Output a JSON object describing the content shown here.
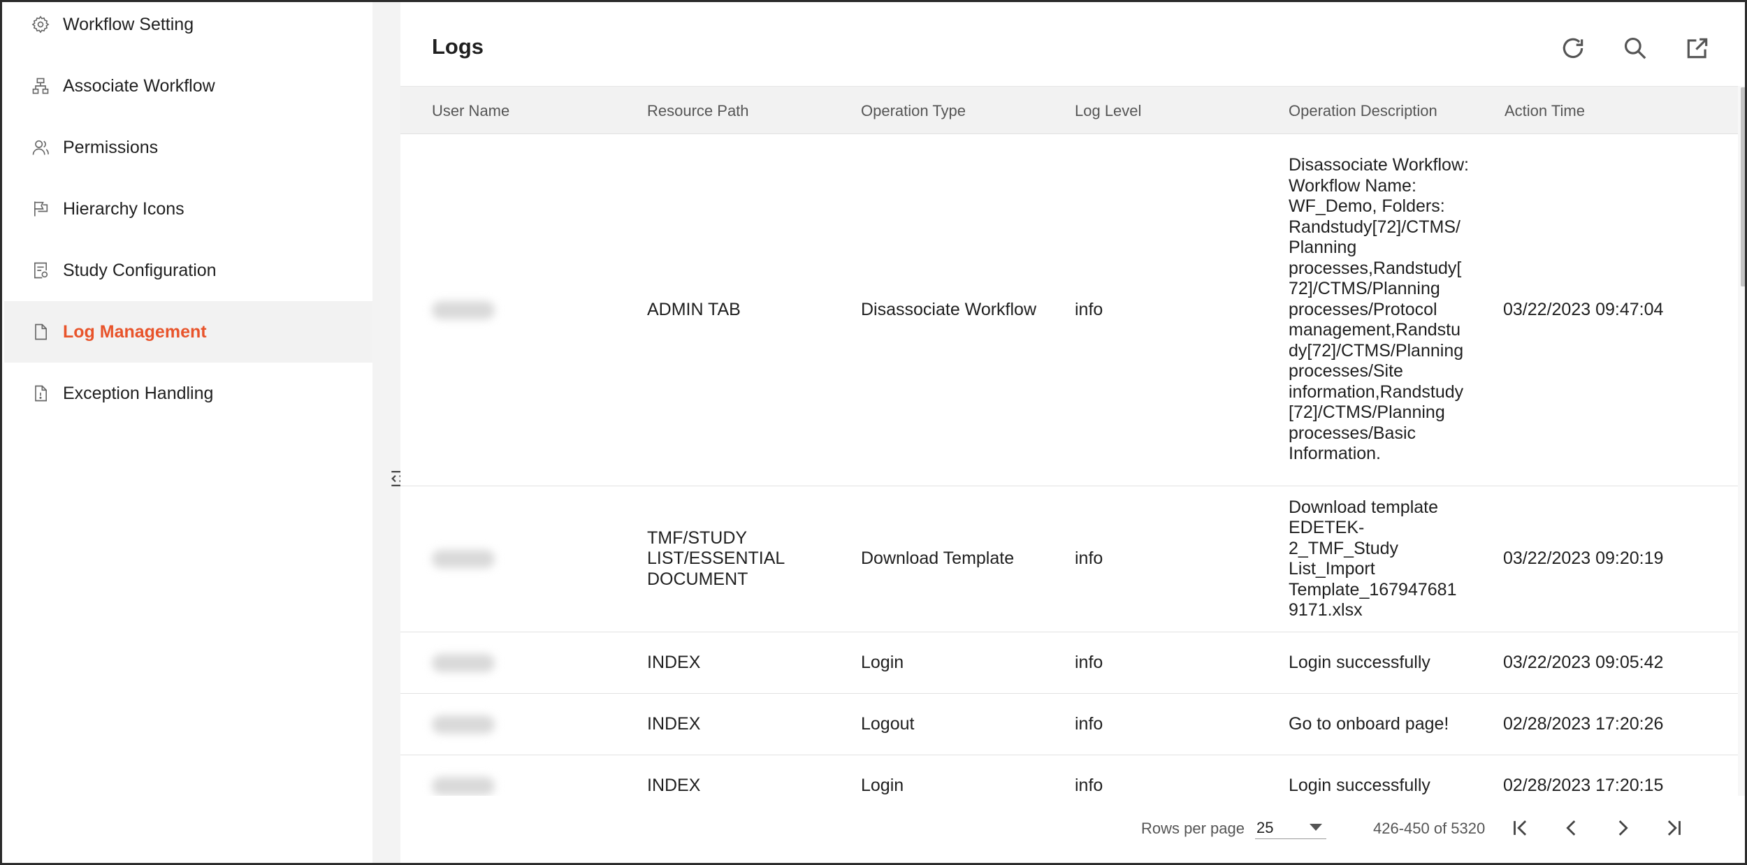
{
  "sidebar": {
    "items": [
      {
        "label": "Workflow Setting",
        "icon": "gear-icon"
      },
      {
        "label": "Associate Workflow",
        "icon": "hierarchy-tree-icon"
      },
      {
        "label": "Permissions",
        "icon": "users-icon"
      },
      {
        "label": "Hierarchy Icons",
        "icon": "flag-icon"
      },
      {
        "label": "Study Configuration",
        "icon": "document-settings-icon"
      },
      {
        "label": "Log Management",
        "icon": "document-icon",
        "active": true
      },
      {
        "label": "Exception Handling",
        "icon": "document-alert-icon"
      }
    ]
  },
  "header": {
    "title": "Logs",
    "icons": [
      "refresh-icon",
      "search-icon",
      "open-external-icon"
    ]
  },
  "table": {
    "columns": [
      "User Name",
      "Resource Path",
      "Operation Type",
      "Log Level",
      "Operation Description",
      "Action Time"
    ],
    "rows": [
      {
        "resource_path": "ADMIN TAB",
        "operation_type": "Disassociate Workflow",
        "log_level": "info",
        "description": "Disassociate Workflow: Workflow Name: WF_Demo, Folders: Randstudy[72]/CTMS/ Planning processes,Randstudy[ 72]/CTMS/Planning processes/Protocol management,Randstu dy[72]/CTMS/Planning processes/Site information,Randstudy [72]/CTMS/Planning processes/Basic Information.",
        "action_time": "03/22/2023 09:47:04"
      },
      {
        "resource_path": "TMF/STUDY LIST/ESSENTIAL DOCUMENT",
        "operation_type": "Download Template",
        "log_level": "info",
        "description": "Download template EDETEK-2_TMF_Study List_Import Template_167947681 9171.xlsx",
        "action_time": "03/22/2023 09:20:19"
      },
      {
        "resource_path": "INDEX",
        "operation_type": "Login",
        "log_level": "info",
        "description": "Login successfully",
        "action_time": "03/22/2023 09:05:42"
      },
      {
        "resource_path": "INDEX",
        "operation_type": "Logout",
        "log_level": "info",
        "description": "Go to onboard page!",
        "action_time": "02/28/2023 17:20:26"
      },
      {
        "resource_path": "INDEX",
        "operation_type": "Login",
        "log_level": "info",
        "description": "Login successfully",
        "action_time": "02/28/2023 17:20:15"
      }
    ]
  },
  "pagination": {
    "rows_per_page_label": "Rows per page",
    "rows_per_page_value": "25",
    "range_text": "426-450 of 5320"
  },
  "colors": {
    "accent": "#e8542b",
    "active_bg": "#f2f2f2",
    "header_bg": "#f2f2f2"
  }
}
